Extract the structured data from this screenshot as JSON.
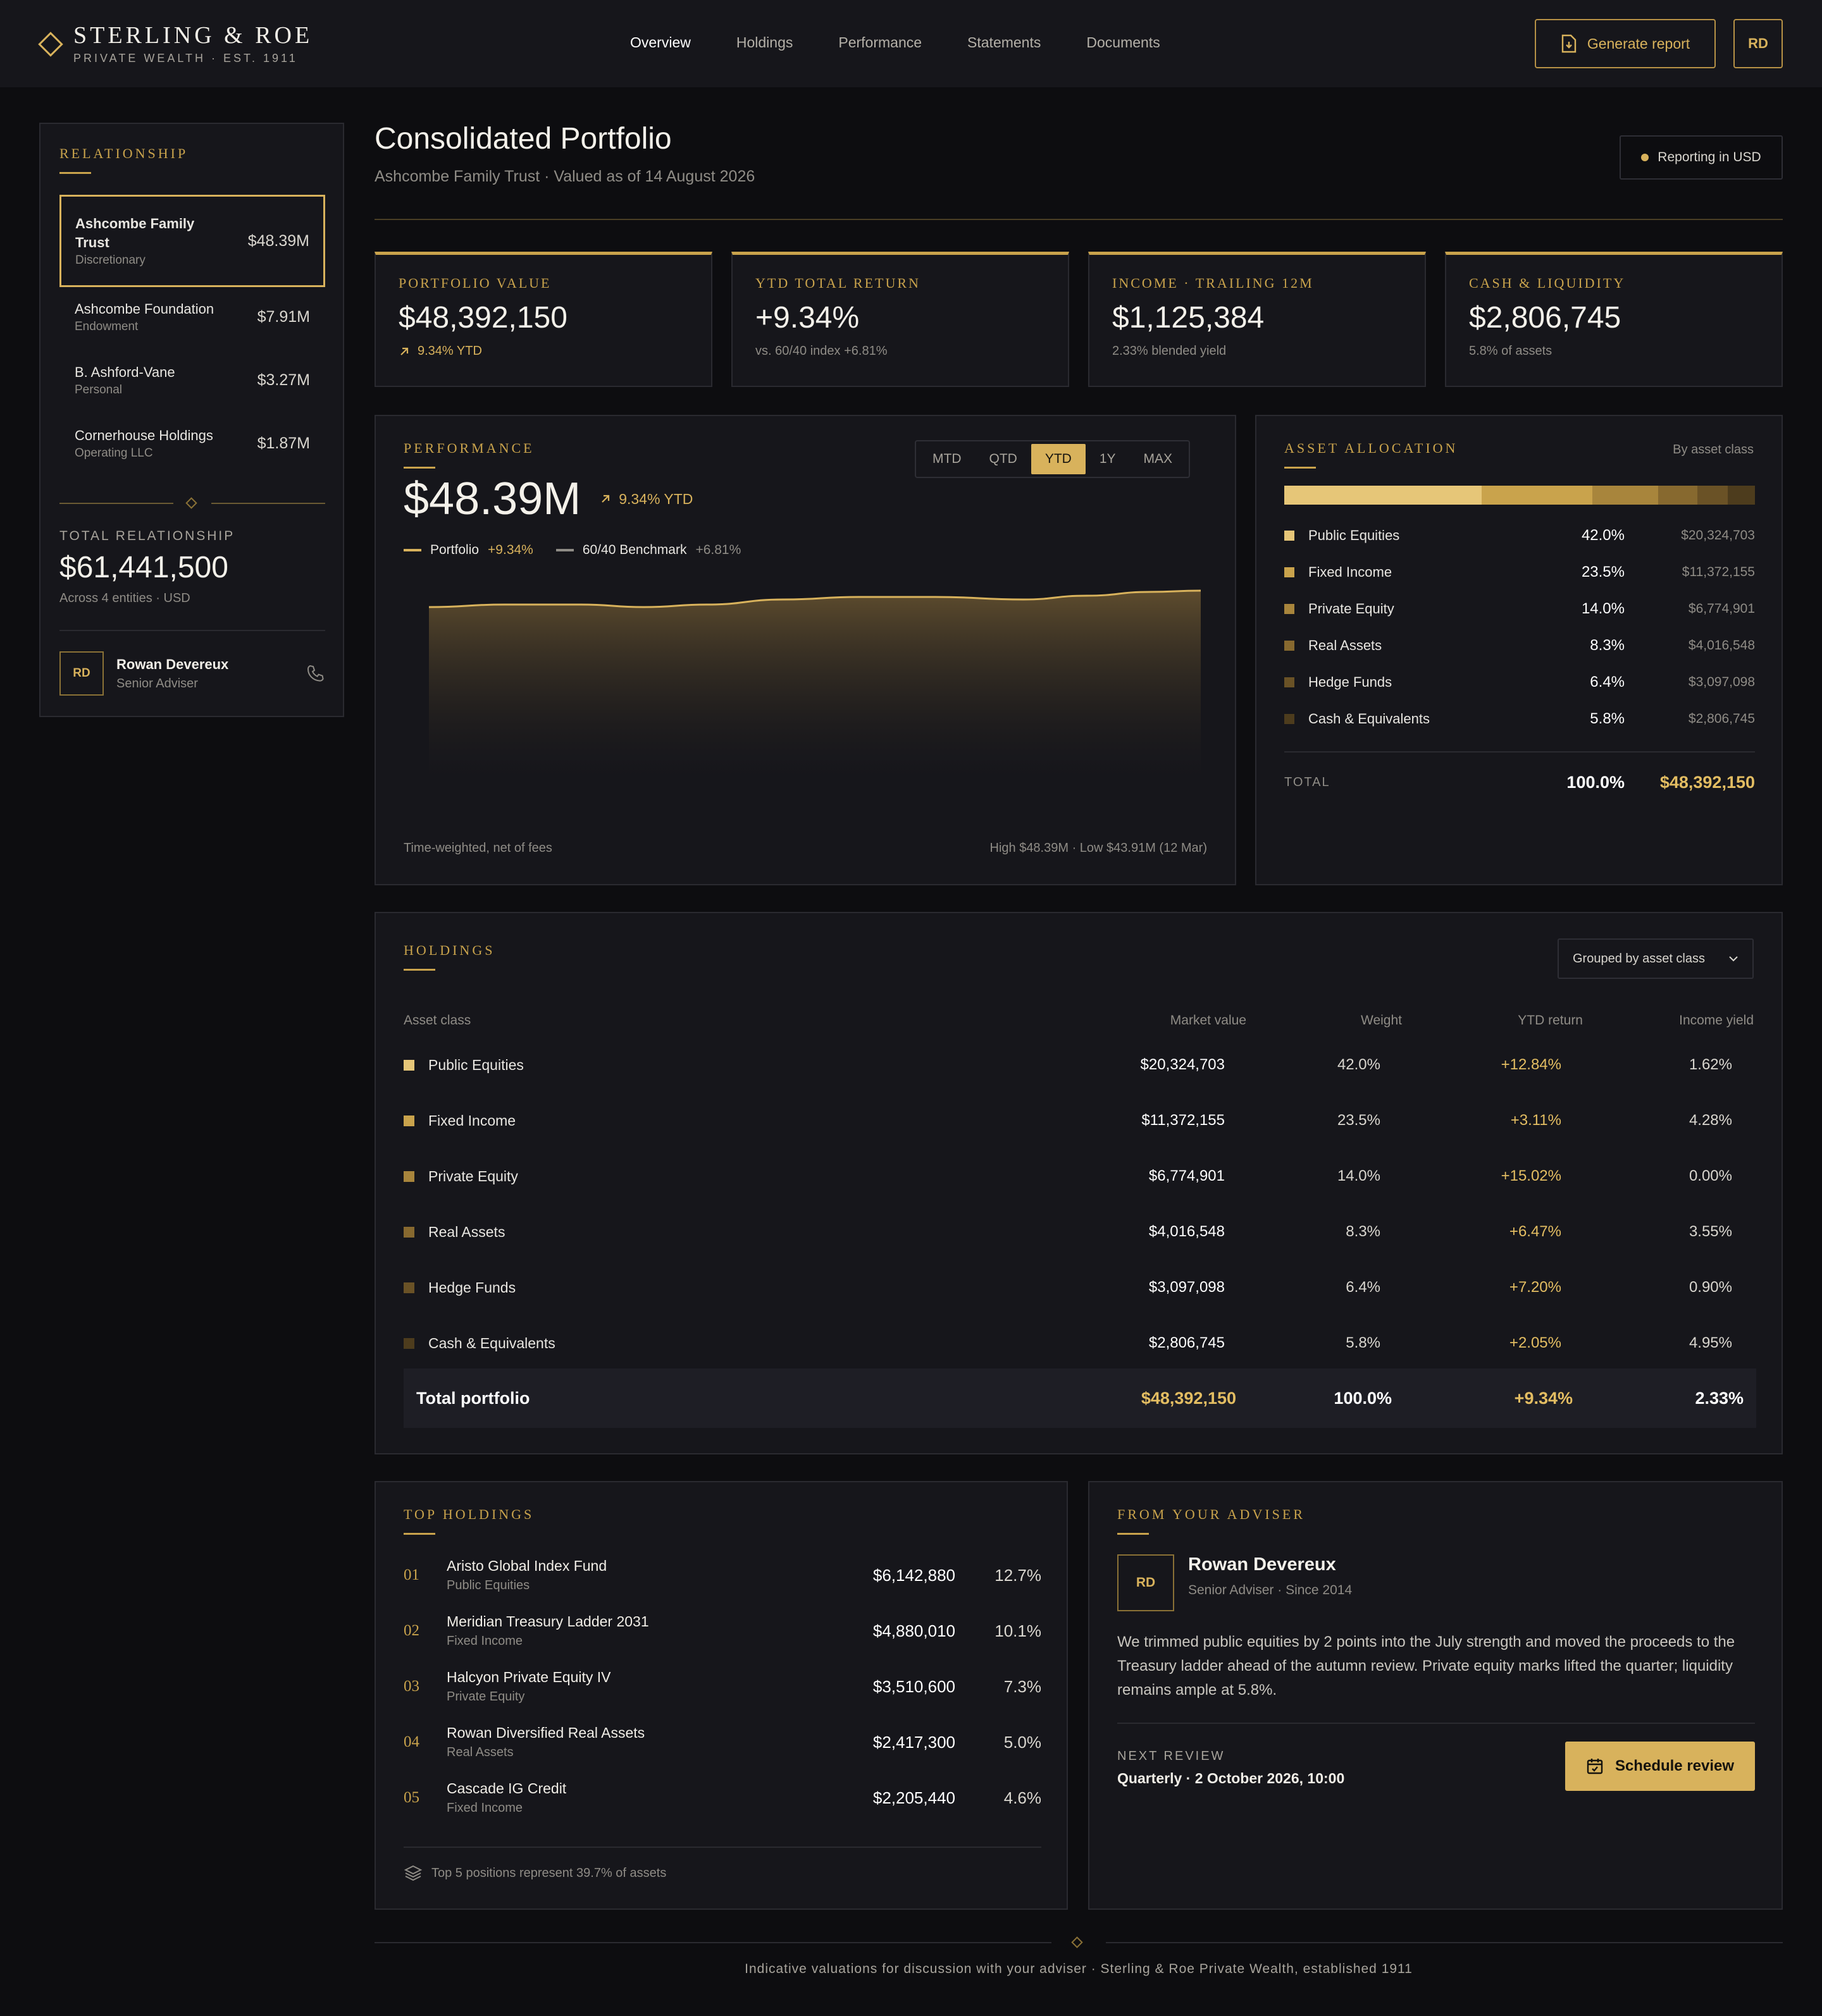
{
  "brand": {
    "name": "STERLING & ROE",
    "tagline": "PRIVATE WEALTH · EST. 1911"
  },
  "nav": [
    "Overview",
    "Holdings",
    "Performance",
    "Statements",
    "Documents"
  ],
  "header": {
    "generate_label": "Generate report",
    "user_initials": "RD"
  },
  "sidebar": {
    "title": "RELATIONSHIP",
    "accounts": [
      {
        "name": "Ashcombe Family Trust",
        "type": "Discretionary",
        "value": "$48.39M"
      },
      {
        "name": "Ashcombe Foundation",
        "type": "Endowment",
        "value": "$7.91M"
      },
      {
        "name": "B. Ashford-Vane",
        "type": "Personal",
        "value": "$3.27M"
      },
      {
        "name": "Cornerhouse Holdings",
        "type": "Operating LLC",
        "value": "$1.87M"
      }
    ],
    "total_label": "TOTAL RELATIONSHIP",
    "total_value": "$61,441,500",
    "total_sub": "Across 4 entities · USD",
    "adviser": {
      "initials": "RD",
      "name": "Rowan Devereux",
      "role": "Senior Adviser"
    }
  },
  "page": {
    "title": "Consolidated Portfolio",
    "subtitle": "Ashcombe Family Trust · Valued as of 14 August 2026",
    "reporting": "Reporting in USD"
  },
  "kpis": [
    {
      "label": "PORTFOLIO VALUE",
      "value": "$48,392,150",
      "sub": "9.34% YTD"
    },
    {
      "label": "YTD TOTAL RETURN",
      "value": "+9.34%",
      "sub": "vs. 60/40 index +6.81%"
    },
    {
      "label": "INCOME · TRAILING 12M",
      "value": "$1,125,384",
      "sub": "2.33% blended yield"
    },
    {
      "label": "CASH & LIQUIDITY",
      "value": "$2,806,745",
      "sub": "5.8% of assets"
    }
  ],
  "performance": {
    "title": "PERFORMANCE",
    "value": "$48.39M",
    "change": "9.34% YTD",
    "ranges": [
      "MTD",
      "QTD",
      "YTD",
      "1Y",
      "MAX"
    ],
    "active_range": "YTD",
    "legend": [
      {
        "name": "Portfolio",
        "value": "+9.34%",
        "color": "#d8b25c"
      },
      {
        "name": "60/40 Benchmark",
        "value": "+6.81%",
        "color": "#8f8c86"
      }
    ],
    "footnote": "Time-weighted, net of fees",
    "range_note": "High $48.39M · Low $43.91M (12 Mar)"
  },
  "allocation": {
    "title": "ASSET ALLOCATION",
    "mode": "By asset class",
    "items": [
      {
        "name": "Public Equities",
        "pct": "42.0%",
        "value": "$20,324,703",
        "weight": 42.0,
        "color": "#e6c678"
      },
      {
        "name": "Fixed Income",
        "pct": "23.5%",
        "value": "$11,372,155",
        "weight": 23.5,
        "color": "#c9a34c"
      },
      {
        "name": "Private Equity",
        "pct": "14.0%",
        "value": "$6,774,901",
        "weight": 14.0,
        "color": "#a8853c"
      },
      {
        "name": "Real Assets",
        "pct": "8.3%",
        "value": "$4,016,548",
        "weight": 8.3,
        "color": "#87692f"
      },
      {
        "name": "Hedge Funds",
        "pct": "6.4%",
        "value": "$3,097,098",
        "weight": 6.4,
        "color": "#6a5226"
      },
      {
        "name": "Cash & Equivalents",
        "pct": "5.8%",
        "value": "$2,806,745",
        "weight": 5.8,
        "color": "#4d3c1d"
      }
    ],
    "total_label": "TOTAL",
    "total_pct": "100.0%",
    "total_value": "$48,392,150"
  },
  "holdings": {
    "title": "HOLDINGS",
    "grouping": "Grouped by asset class",
    "columns": [
      "Asset class",
      "Market value",
      "Weight",
      "YTD return",
      "Income yield"
    ],
    "rows": [
      {
        "name": "Public Equities",
        "value": "$20,324,703",
        "weight": "42.0%",
        "ytd": "+12.84%",
        "yield": "1.62%",
        "color": "#e6c678"
      },
      {
        "name": "Fixed Income",
        "value": "$11,372,155",
        "weight": "23.5%",
        "ytd": "+3.11%",
        "yield": "4.28%",
        "color": "#c9a34c"
      },
      {
        "name": "Private Equity",
        "value": "$6,774,901",
        "weight": "14.0%",
        "ytd": "+15.02%",
        "yield": "0.00%",
        "color": "#a8853c"
      },
      {
        "name": "Real Assets",
        "value": "$4,016,548",
        "weight": "8.3%",
        "ytd": "+6.47%",
        "yield": "3.55%",
        "color": "#87692f"
      },
      {
        "name": "Hedge Funds",
        "value": "$3,097,098",
        "weight": "6.4%",
        "ytd": "+7.20%",
        "yield": "0.90%",
        "color": "#6a5226"
      },
      {
        "name": "Cash & Equivalents",
        "value": "$2,806,745",
        "weight": "5.8%",
        "ytd": "+2.05%",
        "yield": "4.95%",
        "color": "#4d3c1d"
      }
    ],
    "total": {
      "name": "Total portfolio",
      "value": "$48,392,150",
      "weight": "100.0%",
      "ytd": "+9.34%",
      "yield": "2.33%"
    }
  },
  "top_holdings": {
    "title": "TOP HOLDINGS",
    "items": [
      {
        "rank": "01",
        "name": "Aristo Global Index Fund",
        "class": "Public Equities",
        "value": "$6,142,880",
        "pct": "12.7%"
      },
      {
        "rank": "02",
        "name": "Meridian Treasury Ladder 2031",
        "class": "Fixed Income",
        "value": "$4,880,010",
        "pct": "10.1%"
      },
      {
        "rank": "03",
        "name": "Halcyon Private Equity IV",
        "class": "Private Equity",
        "value": "$3,510,600",
        "pct": "7.3%"
      },
      {
        "rank": "04",
        "name": "Rowan Diversified Real Assets",
        "class": "Real Assets",
        "value": "$2,417,300",
        "pct": "5.0%"
      },
      {
        "rank": "05",
        "name": "Cascade IG Credit",
        "class": "Fixed Income",
        "value": "$2,205,440",
        "pct": "4.6%"
      }
    ],
    "footnote": "Top 5 positions represent 39.7% of assets"
  },
  "adviser_note": {
    "title": "FROM YOUR ADVISER",
    "initials": "RD",
    "name": "Rowan Devereux",
    "role": "Senior Adviser · Since 2014",
    "message": "We trimmed public equities by 2 points into the July strength and moved the proceeds to the Treasury ladder ahead of the autumn review. Private equity marks lifted the quarter; liquidity remains ample at 5.8%.",
    "next_label": "NEXT REVIEW",
    "next_value": "Quarterly · 2 October 2026, 10:00",
    "button": "Schedule review"
  },
  "footer": "Indicative valuations for discussion with your adviser · Sterling & Roe Private Wealth, established 1911"
}
